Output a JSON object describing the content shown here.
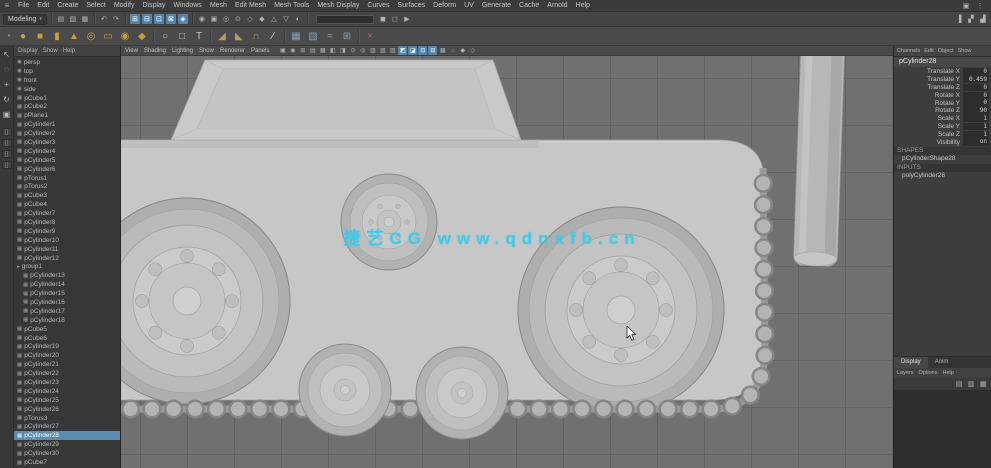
{
  "icons": {
    "logo": "≡",
    "caret": "▾"
  },
  "menubar": {
    "items": [
      "File",
      "Edit",
      "Create",
      "Select",
      "Modify",
      "Display",
      "Windows",
      "Mesh",
      "Edit Mesh",
      "Mesh Tools",
      "Mesh Display",
      "Curves",
      "Surfaces",
      "Deform",
      "UV",
      "Generate",
      "Cache",
      "Arnold",
      "Help"
    ],
    "right_icons": [
      {
        "name": "workspace-icon",
        "glyph": "▣"
      },
      {
        "name": "menu-overflow-icon",
        "glyph": "⋮"
      }
    ]
  },
  "status_line": {
    "menuset": "Modeling",
    "file_icons": [
      {
        "name": "new-scene-icon",
        "glyph": "▤"
      },
      {
        "name": "open-scene-icon",
        "glyph": "▨"
      },
      {
        "name": "save-scene-icon",
        "glyph": "▦"
      }
    ],
    "history_icons": [
      {
        "name": "undo-icon",
        "glyph": "↶"
      },
      {
        "name": "redo-icon",
        "glyph": "↷"
      }
    ],
    "snap_icons": [
      {
        "name": "snap-grid-icon",
        "glyph": "⊞",
        "active": true
      },
      {
        "name": "snap-curve-icon",
        "glyph": "⊟",
        "active": true
      },
      {
        "name": "snap-point-icon",
        "glyph": "⊡",
        "active": true
      },
      {
        "name": "snap-view-plane-icon",
        "glyph": "⊠",
        "active": true
      },
      {
        "name": "make-live-icon",
        "glyph": "◈",
        "active": true
      }
    ],
    "mask_icons": [
      {
        "name": "select-hierarchy-icon",
        "glyph": "◉"
      },
      {
        "name": "select-object-icon",
        "glyph": "▣"
      },
      {
        "name": "select-component-icon",
        "glyph": "◎"
      },
      {
        "name": "select-point-icon",
        "glyph": "⊙"
      },
      {
        "name": "select-line-icon",
        "glyph": "◇"
      },
      {
        "name": "select-face-icon",
        "glyph": "◆"
      },
      {
        "name": "select-hull-icon",
        "glyph": "△"
      },
      {
        "name": "select-misc-icon",
        "glyph": "▽"
      },
      {
        "name": "highlight-selection-icon",
        "glyph": "◐"
      }
    ],
    "render_icons": [
      {
        "name": "render-icon",
        "glyph": "◼"
      },
      {
        "name": "ipr-render-icon",
        "glyph": "◻"
      },
      {
        "name": "render-settings-icon",
        "glyph": "▶"
      }
    ],
    "sidebar_icons": [
      {
        "name": "attribute-editor-toggle-icon",
        "glyph": "▐"
      },
      {
        "name": "tool-settings-toggle-icon",
        "glyph": "▞"
      },
      {
        "name": "channel-box-toggle-icon",
        "glyph": "▟"
      }
    ]
  },
  "shelf": {
    "icons": [
      {
        "name": "poly-sphere-tool",
        "glyph": "●",
        "color": "#cf9c3c"
      },
      {
        "name": "poly-cube-tool",
        "glyph": "■",
        "color": "#cf9c3c"
      },
      {
        "name": "poly-cylinder-tool",
        "glyph": "▮",
        "color": "#cf9c3c"
      },
      {
        "name": "poly-cone-tool",
        "glyph": "▲",
        "color": "#cf9c3c"
      },
      {
        "name": "poly-torus-tool",
        "glyph": "◎",
        "color": "#cf9c3c"
      },
      {
        "name": "poly-plane-tool",
        "glyph": "▭",
        "color": "#cf9c3c"
      },
      {
        "name": "poly-disc-tool",
        "glyph": "◉",
        "color": "#cf9c3c"
      },
      {
        "name": "poly-platonic-tool",
        "glyph": "◆",
        "color": "#cf9c3c"
      },
      {
        "sep": true
      },
      {
        "name": "nurbs-circle-tool",
        "glyph": "○",
        "color": "#c8c8c8"
      },
      {
        "name": "nurbs-square-tool",
        "glyph": "□",
        "color": "#c8c8c8"
      },
      {
        "name": "text-tool",
        "glyph": "T",
        "color": "#c8c8c8"
      },
      {
        "sep": true
      },
      {
        "name": "extrude-tool",
        "glyph": "◢",
        "color": "#b89a68"
      },
      {
        "name": "bevel-tool",
        "glyph": "◣",
        "color": "#b89a68"
      },
      {
        "name": "bridge-tool",
        "glyph": "∩",
        "color": "#b89a68"
      },
      {
        "name": "multi-cut-tool",
        "glyph": "∕",
        "color": "#e0e0e0"
      },
      {
        "sep": true
      },
      {
        "name": "quad-draw-tool",
        "glyph": "▦",
        "color": "#7fa3c0"
      },
      {
        "name": "uv-editor-tool",
        "glyph": "▧",
        "color": "#7fa3c0"
      },
      {
        "name": "smooth-tool",
        "glyph": "≈",
        "color": "#7fa3c0"
      },
      {
        "name": "mirror-tool",
        "glyph": "⊞",
        "color": "#7fa3c0"
      },
      {
        "sep": true
      },
      {
        "name": "delete-history-tool",
        "glyph": "×",
        "color": "#c05a5a"
      }
    ]
  },
  "toolbox": {
    "tools": [
      {
        "name": "select-tool-icon",
        "glyph": "↖"
      },
      {
        "name": "lasso-tool-icon",
        "glyph": "◌"
      },
      {
        "name": "move-tool-icon",
        "glyph": "+"
      },
      {
        "name": "rotate-tool-icon",
        "glyph": "↻"
      },
      {
        "name": "scale-tool-icon",
        "glyph": "▣"
      }
    ],
    "layouts": [
      {
        "name": "layout-single-pane-icon",
        "glyph": "▯"
      },
      {
        "name": "layout-four-pane-icon",
        "glyph": "▯"
      },
      {
        "name": "layout-split-pane-icon",
        "glyph": "▯"
      },
      {
        "name": "layout-outliner-persp-icon",
        "glyph": "▯"
      }
    ]
  },
  "outliner": {
    "menus": [
      "Display",
      "Show",
      "Help"
    ],
    "items": [
      {
        "label": "persp",
        "glyph": "◉"
      },
      {
        "label": "top",
        "glyph": "◉"
      },
      {
        "label": "front",
        "glyph": "◉"
      },
      {
        "label": "side",
        "glyph": "◉"
      },
      {
        "label": "pCube1",
        "glyph": "▦"
      },
      {
        "label": "pCube2",
        "glyph": "▦"
      },
      {
        "label": "pPlane1",
        "glyph": "▦"
      },
      {
        "label": "pCylinder1",
        "glyph": "▦"
      },
      {
        "label": "pCylinder2",
        "glyph": "▦"
      },
      {
        "label": "pCylinder3",
        "glyph": "▦"
      },
      {
        "label": "pCylinder4",
        "glyph": "▦"
      },
      {
        "label": "pCylinder5",
        "glyph": "▦"
      },
      {
        "label": "pCylinder6",
        "glyph": "▦"
      },
      {
        "label": "pTorus1",
        "glyph": "▦"
      },
      {
        "label": "pTorus2",
        "glyph": "▦"
      },
      {
        "label": "pCube3",
        "glyph": "▦"
      },
      {
        "label": "pCube4",
        "glyph": "▦"
      },
      {
        "label": "pCylinder7",
        "glyph": "▦"
      },
      {
        "label": "pCylinder8",
        "glyph": "▦"
      },
      {
        "label": "pCylinder9",
        "glyph": "▦"
      },
      {
        "label": "pCylinder10",
        "glyph": "▦"
      },
      {
        "label": "pCylinder11",
        "glyph": "▦"
      },
      {
        "label": "pCylinder12",
        "glyph": "▦"
      },
      {
        "label": "group1",
        "glyph": "▸"
      },
      {
        "label": "pCylinder13",
        "glyph": "▦",
        "indent": 1
      },
      {
        "label": "pCylinder14",
        "glyph": "▦",
        "indent": 1
      },
      {
        "label": "pCylinder15",
        "glyph": "▦",
        "indent": 1
      },
      {
        "label": "pCylinder16",
        "glyph": "▦",
        "indent": 1
      },
      {
        "label": "pCylinder17",
        "glyph": "▦",
        "indent": 1
      },
      {
        "label": "pCylinder18",
        "glyph": "▦",
        "indent": 1
      },
      {
        "label": "pCube5",
        "glyph": "▦"
      },
      {
        "label": "pCube6",
        "glyph": "▦"
      },
      {
        "label": "pCylinder19",
        "glyph": "▦"
      },
      {
        "label": "pCylinder20",
        "glyph": "▦"
      },
      {
        "label": "pCylinder21",
        "glyph": "▦"
      },
      {
        "label": "pCylinder22",
        "glyph": "▦"
      },
      {
        "label": "pCylinder23",
        "glyph": "▦"
      },
      {
        "label": "pCylinder24",
        "glyph": "▦"
      },
      {
        "label": "pCylinder25",
        "glyph": "▦"
      },
      {
        "label": "pCylinder26",
        "glyph": "▦"
      },
      {
        "label": "pTorus3",
        "glyph": "▦"
      },
      {
        "label": "pCylinder27",
        "glyph": "▦"
      },
      {
        "label": "pCylinder28",
        "glyph": "▦",
        "selected": true
      },
      {
        "label": "pCylinder29",
        "glyph": "▦"
      },
      {
        "label": "pCylinder30",
        "glyph": "▦"
      },
      {
        "label": "pCube7",
        "glyph": "▦"
      }
    ]
  },
  "viewport": {
    "menus": [
      "View",
      "Shading",
      "Lighting",
      "Show",
      "Renderer",
      "Panels"
    ],
    "toolbar_icons": [
      {
        "name": "select-camera-icon",
        "glyph": "▣"
      },
      {
        "name": "lock-camera-icon",
        "glyph": "◉"
      },
      {
        "name": "camera-attributes-icon",
        "glyph": "⊞"
      },
      {
        "name": "bookmark-icon",
        "glyph": "▤"
      },
      {
        "name": "image-plane-icon",
        "glyph": "▦"
      },
      {
        "name": "view-grid-icon",
        "glyph": "◧"
      },
      {
        "name": "film-gate-icon",
        "glyph": "◨"
      },
      {
        "name": "resolution-gate-icon",
        "glyph": "⊙"
      },
      {
        "name": "gate-mask-icon",
        "glyph": "◎"
      },
      {
        "name": "field-chart-icon",
        "glyph": "▥"
      },
      {
        "name": "safe-action-icon",
        "glyph": "▧"
      },
      {
        "name": "safe-title-icon",
        "glyph": "▨"
      },
      {
        "name": "wireframe-icon",
        "glyph": "◩",
        "active": true
      },
      {
        "name": "shaded-icon",
        "glyph": "◪",
        "active": true
      },
      {
        "name": "textured-icon",
        "glyph": "⊡",
        "active": true
      },
      {
        "name": "use-all-lights-icon",
        "glyph": "⊟",
        "active": true
      },
      {
        "name": "shadows-icon",
        "glyph": "▩"
      },
      {
        "name": "ambient-occlusion-icon",
        "glyph": "○"
      },
      {
        "name": "motion-blur-icon",
        "glyph": "◆"
      },
      {
        "name": "isolate-select-icon",
        "glyph": "◇"
      }
    ],
    "watermark": "捷艺CG  www.qdnxfb.cn"
  },
  "channel_box": {
    "menus": [
      "Channels",
      "Edit",
      "Object",
      "Show"
    ],
    "object_name": "pCylinder28",
    "channels": [
      {
        "label": "Translate X",
        "value": "0"
      },
      {
        "label": "Translate Y",
        "value": "0.459"
      },
      {
        "label": "Translate Z",
        "value": "0"
      },
      {
        "label": "Rotate X",
        "value": "0"
      },
      {
        "label": "Rotate Y",
        "value": "0"
      },
      {
        "label": "Rotate Z",
        "value": "90"
      },
      {
        "label": "Scale X",
        "value": "1"
      },
      {
        "label": "Scale Y",
        "value": "1"
      },
      {
        "label": "Scale Z",
        "value": "1"
      },
      {
        "label": "Visibility",
        "value": "on"
      }
    ],
    "shapes_label": "SHAPES",
    "shape_name": "pCylinderShape28",
    "inputs_label": "INPUTS",
    "input_name": "polyCylinder28"
  },
  "layer_editor": {
    "tabs": [
      {
        "label": "Display",
        "active": true
      },
      {
        "label": "Anim"
      }
    ],
    "menus": [
      "Layers",
      "Options",
      "Help"
    ],
    "buttons": [
      {
        "name": "new-empty-layer-icon",
        "glyph": "▤"
      },
      {
        "name": "new-layer-from-selected-icon",
        "glyph": "▥"
      },
      {
        "name": "move-layer-icon",
        "glyph": "▦"
      }
    ]
  }
}
